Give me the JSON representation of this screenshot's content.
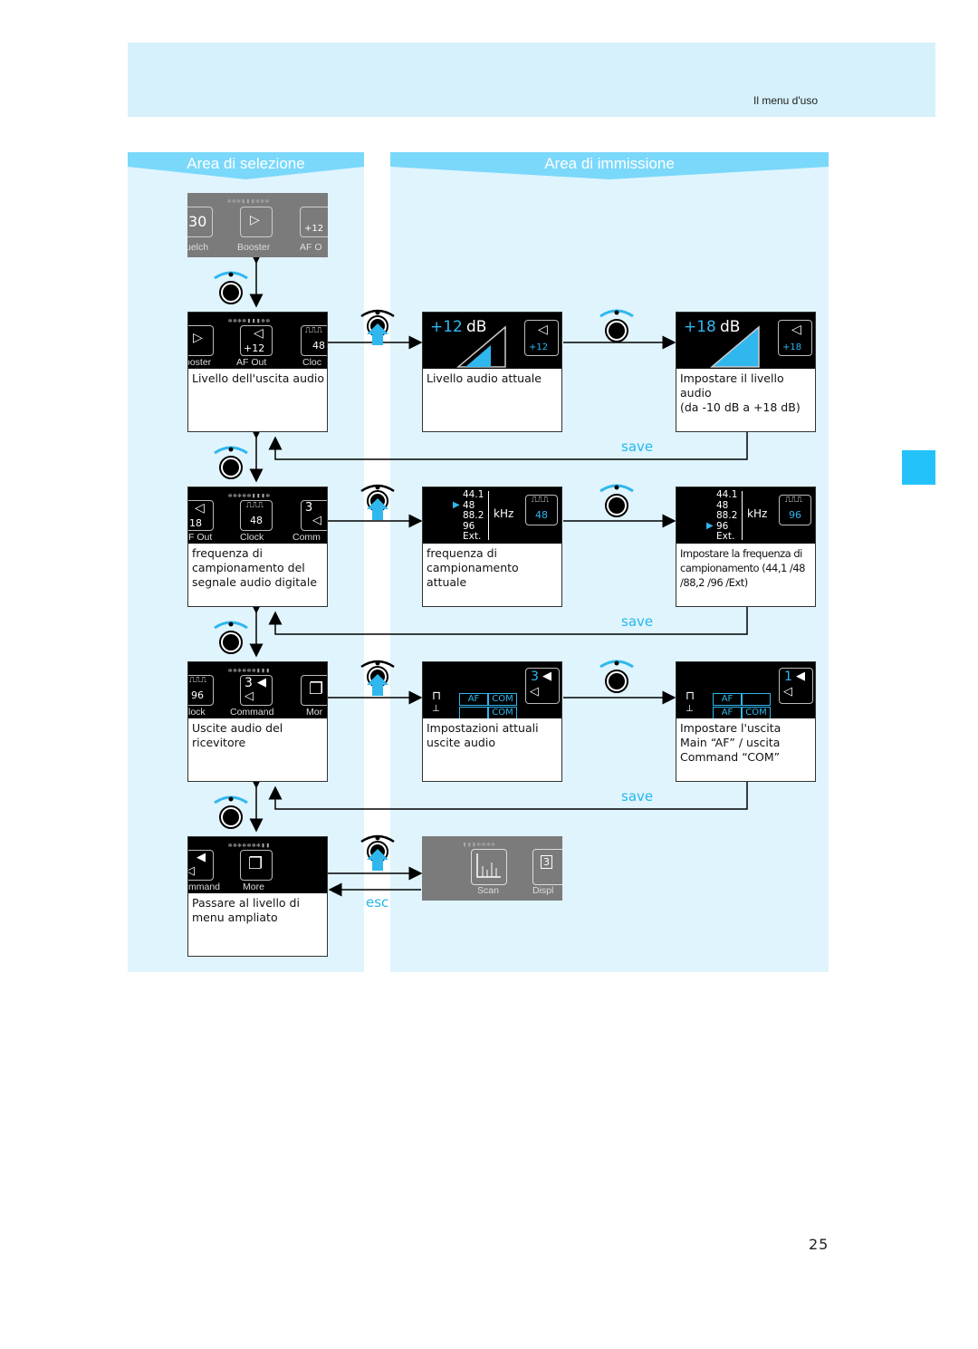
{
  "header": {
    "section_title": "Il menu d'uso"
  },
  "page_number": "25",
  "panels": {
    "selection": {
      "title": "Area di selezione"
    },
    "input": {
      "title": "Area di immissione"
    }
  },
  "colors": {
    "accent": "#24c2fa",
    "panel": "#dff4fd",
    "banner": "#7ad8fb",
    "header": "#d6f1fc"
  },
  "top_lcd": {
    "labels": [
      "uelch",
      "Booster",
      "AF O"
    ],
    "left_value": "30",
    "right_value": "+12"
  },
  "rows": [
    {
      "menu_lcd": {
        "labels": [
          "ooster",
          "AF Out",
          "Cloc"
        ],
        "af_value": "+12",
        "clock_value": "48"
      },
      "menu_caption": "Livello dell'uscita audio",
      "current": {
        "value": "+12",
        "unit": "dB",
        "tile_value": "+12",
        "caption": "Livello audio attuale"
      },
      "setting": {
        "value": "+18",
        "unit": "dB",
        "tile_value": "+18",
        "caption_line1": "Impostare il livello",
        "caption_line2": "audio",
        "caption_line3": "(da -10 dB a +18 dB)"
      },
      "save_label": "save"
    },
    {
      "menu_lcd": {
        "labels": [
          "F Out",
          "Clock",
          "Comm"
        ],
        "af_value": "18",
        "clock_value": "48",
        "comm_value": "3"
      },
      "menu_caption": "frequenza di campionamento del segnale audio digitale",
      "current": {
        "options": [
          "44.1",
          "48",
          "88.2",
          "96",
          "Ext."
        ],
        "selected": "48",
        "unit": "kHz",
        "tile_value": "48",
        "caption": "frequenza di campionamento attuale"
      },
      "setting": {
        "options": [
          "44.1",
          "48",
          "88.2",
          "96",
          "Ext."
        ],
        "selected": "96",
        "unit": "kHz",
        "tile_value": "96",
        "caption": "Impostare la frequenza di campionamento (44,1 /48 /88,2 /96 /Ext)"
      },
      "save_label": "save"
    },
    {
      "menu_lcd": {
        "labels": [
          "lock",
          "Command",
          "Mor"
        ],
        "clock_value": "96",
        "comm_value": "3"
      },
      "menu_caption": "Uscite audio del ricevitore",
      "current": {
        "tile_value": "3",
        "row1": [
          "AF",
          "COM"
        ],
        "row2": [
          "",
          "COM"
        ],
        "caption": "Impostazioni attuali uscite audio"
      },
      "setting": {
        "tile_value": "1",
        "row1": [
          "AF",
          ""
        ],
        "row2": [
          "AF",
          "COM"
        ],
        "caption_line1": "Impostare l'uscita",
        "caption_line2": "Main “AF” / uscita",
        "caption_line3": "Command “COM”"
      },
      "save_label": "save"
    },
    {
      "menu_lcd": {
        "labels": [
          "mmand",
          "More"
        ]
      },
      "menu_caption": "Passare al livello di menu ampliato",
      "extended": {
        "labels": [
          "Scan",
          "Displ"
        ],
        "display_value": "3"
      },
      "esc_label": "esc"
    }
  ]
}
